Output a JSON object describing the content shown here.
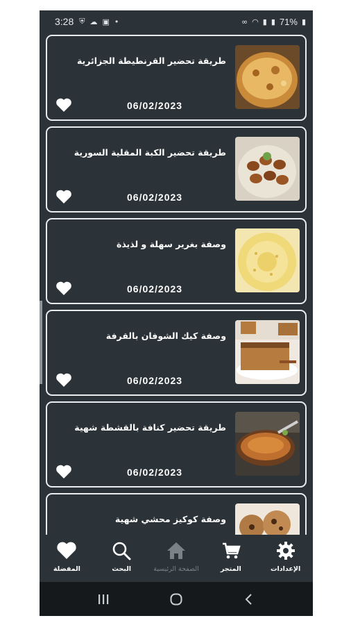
{
  "status_bar": {
    "time": "3:28",
    "battery": "71%"
  },
  "recipes": [
    {
      "title": "طريقة تحضير القرنطيطة الجزائرية",
      "date": "06/02/2023",
      "image": "karantita-photo"
    },
    {
      "title": "طريقة تحضير الكبة المقلية السورية",
      "date": "06/02/2023",
      "image": "kibbeh-photo"
    },
    {
      "title": "وصفة بغرير سهلة و لذيذة",
      "date": "06/02/2023",
      "image": "baghrir-photo"
    },
    {
      "title": "وصفة كيك الشوفان بالقرفة",
      "date": "06/02/2023",
      "image": "oat-cake-photo"
    },
    {
      "title": "طريقة تحضير كنافة بالقشطة شهية",
      "date": "06/02/2023",
      "image": "knafeh-photo"
    },
    {
      "title": "وصفة كوكيز محشي شهية",
      "date": "",
      "image": "cookies-photo"
    }
  ],
  "bottom_nav": {
    "settings": "الإعدادات",
    "store": "المتجر",
    "home": "الصفحة الرئيسية",
    "search": "البحث",
    "favorites": "المفضلة"
  },
  "colors": {
    "background": "#2b3338",
    "card_border": "#e9ecee",
    "inactive": "#7a8287"
  }
}
